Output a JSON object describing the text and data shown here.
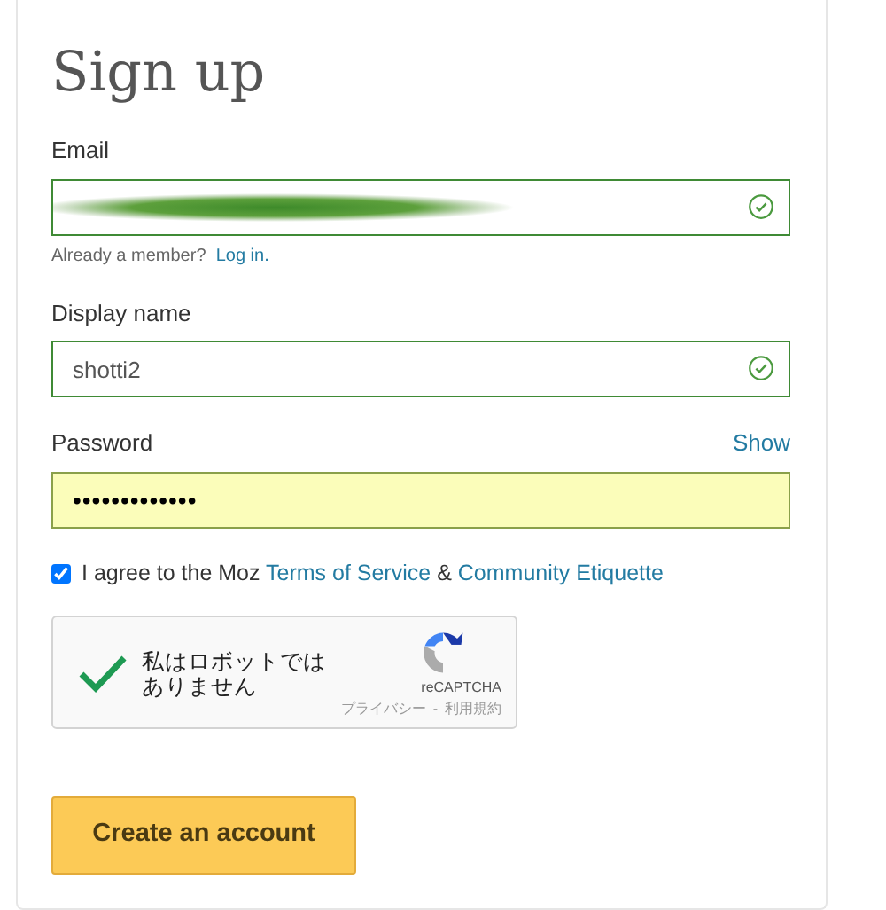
{
  "title": "Sign up",
  "fields": [
    {
      "label": "Email",
      "value_hidden": true,
      "valid": true,
      "highlighted": false
    },
    {
      "label": "Display name",
      "value": "shotti2",
      "valid": true,
      "highlighted": false
    },
    {
      "label": "Password",
      "value": "•••••••••••••",
      "valid": false,
      "highlighted": true,
      "action": "Show"
    }
  ],
  "member_hint": {
    "text": "Already a member?",
    "link": "Log in."
  },
  "agreement": {
    "checked": true,
    "text": "I agree to the Moz",
    "link_1": "Terms of Service",
    "joiner": "&",
    "link_2": "Community Etiquette"
  },
  "captcha": {
    "checked": true,
    "text": "私はロボットではありません",
    "brand": "reCAPTCHA",
    "privacy": "プライバシー",
    "separator": "-",
    "terms": "利用規約"
  },
  "submit": "Create an account"
}
